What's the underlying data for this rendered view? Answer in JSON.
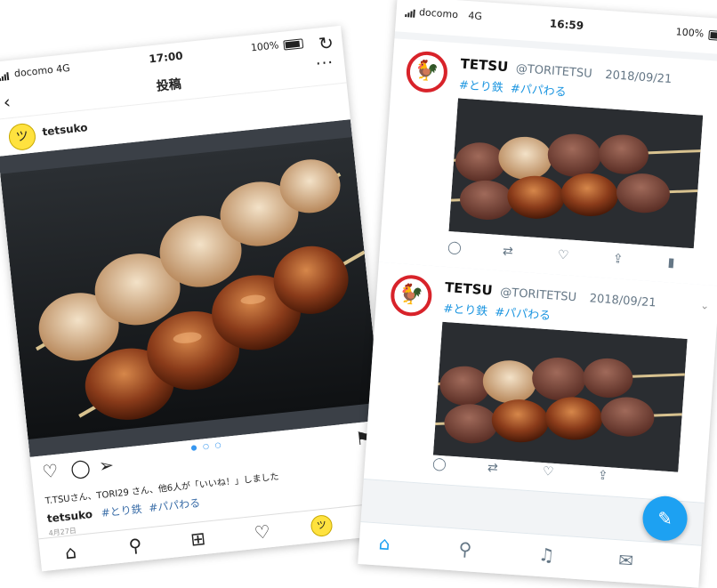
{
  "instagram": {
    "status": {
      "carrier": "docomo",
      "network": "4G",
      "time": "17:00",
      "battery": "100%"
    },
    "header": {
      "title": "投稿"
    },
    "post": {
      "username": "tetsuko",
      "likes": "T.TSUさん、TORI29 さん、他6人が「いいね！」しました",
      "caption_user": "tetsuko",
      "tags": [
        "#とり鉄",
        "#パパわる"
      ],
      "date": "4月27日"
    }
  },
  "twitter": {
    "status": {
      "carrier": "docomo",
      "network": "4G",
      "time": "16:59",
      "battery": "100%"
    },
    "tweets": [
      {
        "name": "TETSU",
        "handle": "@TORITETSU",
        "date": "2018/09/21",
        "tags": [
          "#とり鉄",
          "#パパわる"
        ]
      },
      {
        "name": "TETSU",
        "handle": "@TORITETSU",
        "date": "2018/09/21",
        "tags": [
          "#とり鉄",
          "#パパわる"
        ]
      }
    ]
  },
  "colors": {
    "accent": "#1da1f2",
    "hashtag": "#1b95e0",
    "brand": "#d8232a",
    "avatar": "#ffe23f"
  },
  "icons": [
    "back-icon",
    "refresh-icon",
    "more-icon",
    "heart-icon",
    "comment-icon",
    "share-icon",
    "bookmark-icon",
    "home-icon",
    "search-icon",
    "add-icon",
    "reply-icon",
    "retweet-icon",
    "analytics-icon",
    "compose-icon",
    "bell-icon",
    "mail-icon"
  ]
}
